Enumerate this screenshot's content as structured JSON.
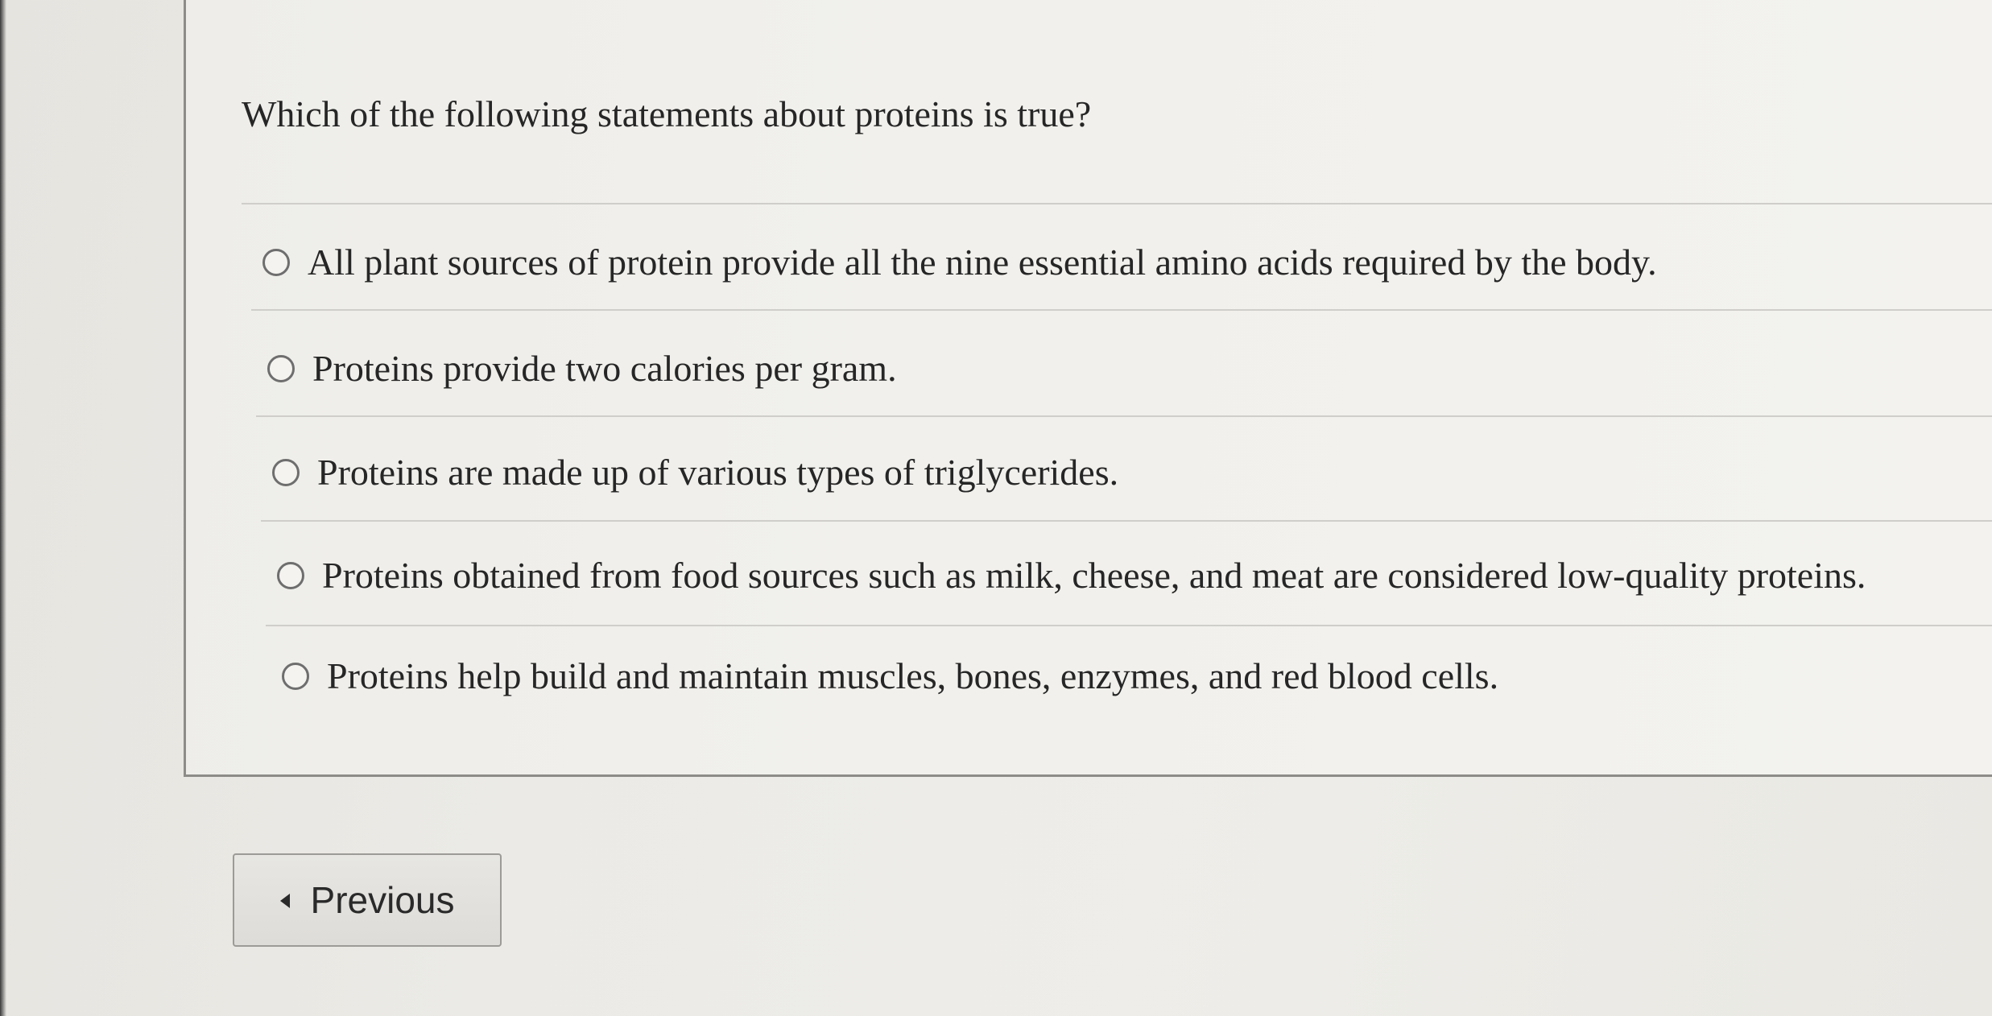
{
  "question": {
    "text": "Which of the following statements about proteins is true?"
  },
  "options": [
    {
      "label": "All plant sources of protein provide all the nine essential amino acids required by the body.",
      "selected": false
    },
    {
      "label": "Proteins provide two calories per gram.",
      "selected": false
    },
    {
      "label": "Proteins are made up of various types of triglycerides.",
      "selected": false
    },
    {
      "label": "Proteins obtained from food sources such as milk, cheese, and meat are considered low-quality proteins.",
      "selected": false
    },
    {
      "label": "Proteins help build and maintain muscles, bones, enzymes, and red blood cells.",
      "selected": false
    }
  ],
  "navigation": {
    "previous_label": "Previous",
    "previous_icon": "caret-left-icon"
  },
  "colors": {
    "background": "#ebeae6",
    "panel_border": "#8d8c88",
    "text": "#262626"
  }
}
